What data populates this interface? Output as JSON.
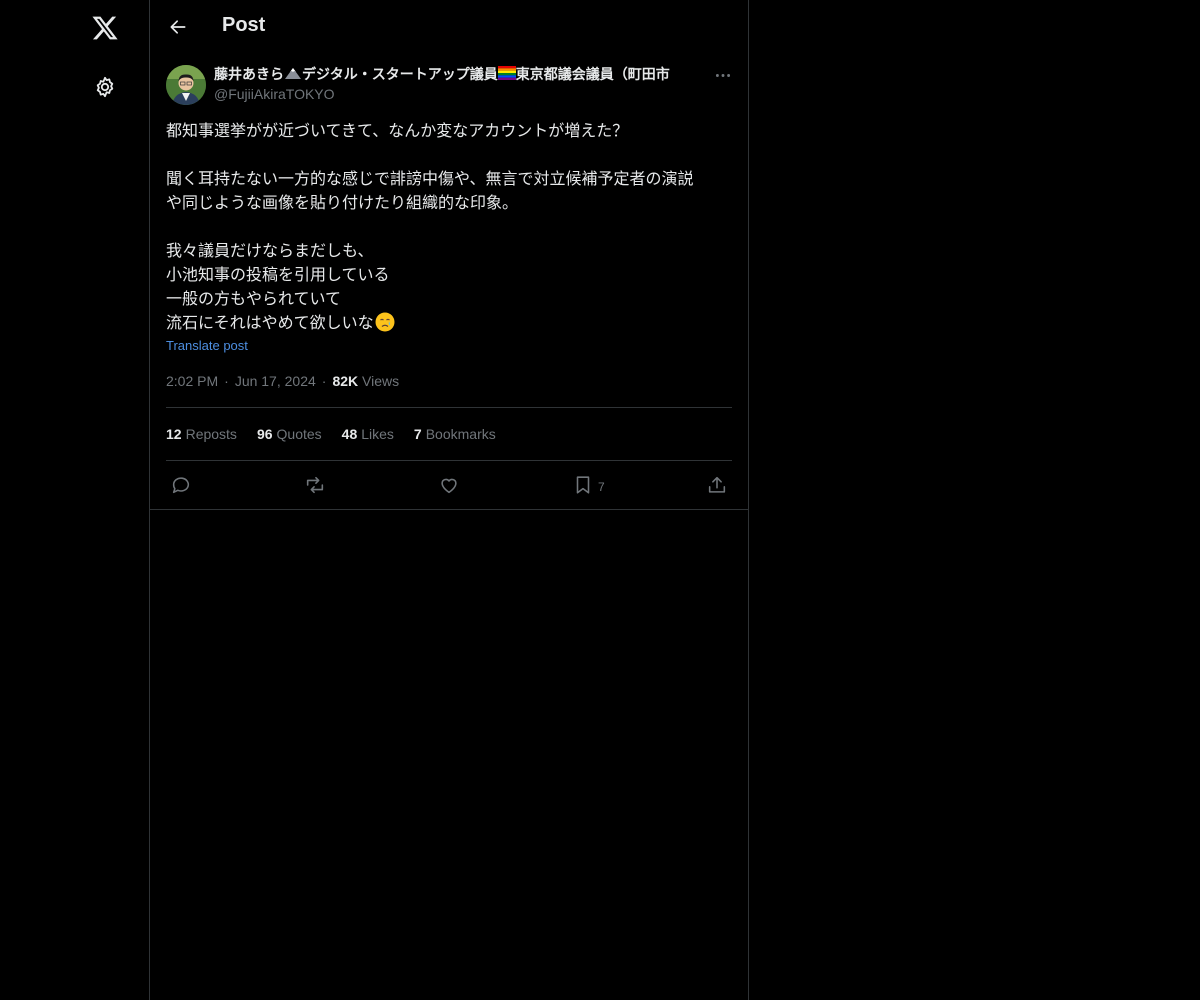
{
  "nav": {
    "logo_icon": "x-logo-icon",
    "settings_icon": "gear-icon"
  },
  "header": {
    "title": "Post",
    "back_icon": "arrow-left-icon"
  },
  "author": {
    "name": "藤井あきら⛰️デジタル・スタートアップ議員🏳️‍🌈東京都議会議員（町田市",
    "name_part1": "藤井あきら",
    "name_part2": "デジタル・スタートアップ議員",
    "name_part3": "東京都議会議員（町田市",
    "handle": "@FujiiAkiraTOKYO"
  },
  "post": {
    "lines": [
      "都知事選挙がが近づいてきて、なんか変なアカウントが増えた？",
      "",
      "聞く耳持たない一方的な感じで誹謗中傷や、無言で対立候補予定者の演説",
      "や同じような画像を貼り付けたり組織的な印象。",
      "",
      "我々議員だけならまだしも、",
      "小池知事の投稿を引用している",
      "一般の方もやられていて",
      "流石にそれはやめて欲しいな"
    ],
    "translate_label": "Translate post",
    "time": "2:02 PM",
    "date": "Jun 17, 2024",
    "views_count": "82K",
    "views_label": "Views"
  },
  "stats": [
    {
      "count": "12",
      "label": "Reposts"
    },
    {
      "count": "96",
      "label": "Quotes"
    },
    {
      "count": "48",
      "label": "Likes"
    },
    {
      "count": "7",
      "label": "Bookmarks"
    }
  ],
  "actions": {
    "bookmark_count": "7"
  },
  "colors": {
    "background": "#000000",
    "text": "#e7e9ea",
    "muted": "#71767b",
    "border": "#2f3336",
    "link": "#4d8ee0"
  }
}
